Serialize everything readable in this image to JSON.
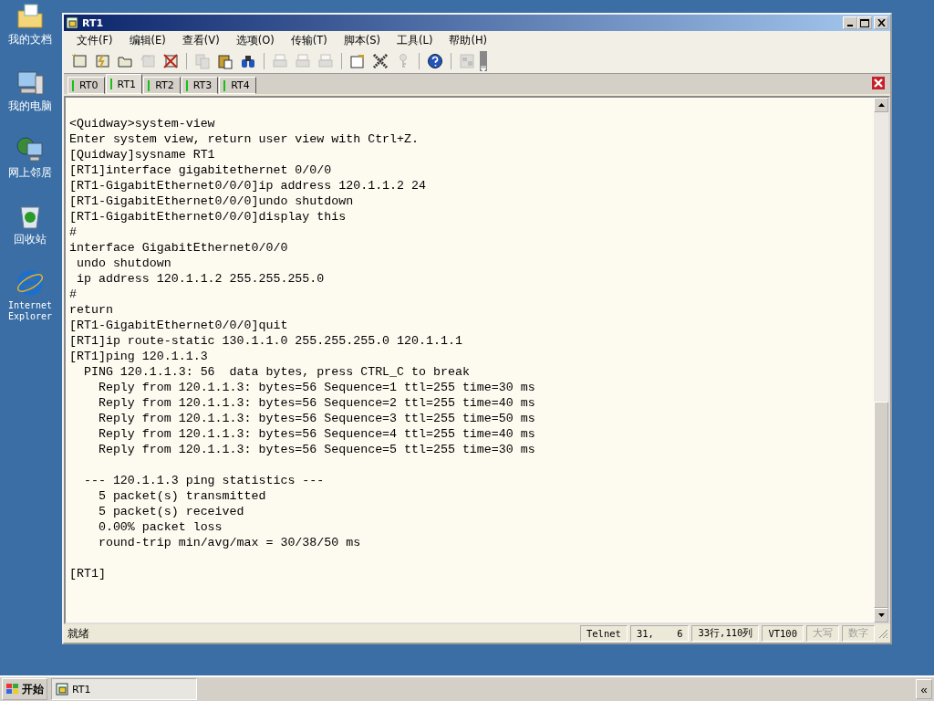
{
  "desktop_icons": [
    {
      "kind": "documents",
      "label": "我的文档"
    },
    {
      "kind": "computer",
      "label": "我的电脑"
    },
    {
      "kind": "network",
      "label": "网上邻居"
    },
    {
      "kind": "recycle",
      "label": "回收站"
    },
    {
      "kind": "browser",
      "label": "Internet Explorer"
    }
  ],
  "window": {
    "title": "RT1"
  },
  "menu": [
    "文件(F)",
    "编辑(E)",
    "查看(V)",
    "选项(O)",
    "传输(T)",
    "脚本(S)",
    "工具(L)",
    "帮助(H)"
  ],
  "toolbar": [
    {
      "kind": "connect",
      "disabled": false
    },
    {
      "kind": "quick-connect",
      "disabled": false
    },
    {
      "kind": "folder",
      "disabled": false
    },
    {
      "kind": "reconnect",
      "disabled": true
    },
    {
      "kind": "disconnect",
      "disabled": false
    },
    {
      "kind": "separator"
    },
    {
      "kind": "copy",
      "disabled": true
    },
    {
      "kind": "paste",
      "disabled": false
    },
    {
      "kind": "find",
      "disabled": false
    },
    {
      "kind": "separator"
    },
    {
      "kind": "print",
      "disabled": true
    },
    {
      "kind": "print-setup",
      "disabled": true
    },
    {
      "kind": "printer",
      "disabled": true
    },
    {
      "kind": "separator"
    },
    {
      "kind": "options",
      "disabled": false
    },
    {
      "kind": "tools",
      "disabled": false
    },
    {
      "kind": "key",
      "disabled": true
    },
    {
      "kind": "separator"
    },
    {
      "kind": "help",
      "disabled": false
    },
    {
      "kind": "separator"
    },
    {
      "kind": "window",
      "disabled": true
    }
  ],
  "tabs": [
    {
      "label": "RT0",
      "selected": false
    },
    {
      "label": "RT1",
      "selected": true
    },
    {
      "label": "RT2",
      "selected": false
    },
    {
      "label": "RT3",
      "selected": false
    },
    {
      "label": "RT4",
      "selected": false
    }
  ],
  "terminal": {
    "lines": [
      {
        "kind": "text",
        "text": "<Quidway>system-view"
      },
      {
        "kind": "text",
        "text": "Enter system view, return user view with Ctrl+Z."
      },
      {
        "kind": "text",
        "text": "[Quidway]sysname RT1"
      },
      {
        "kind": "text",
        "text": "[RT1]interface gigabitethernet 0/0/0"
      },
      {
        "kind": "text",
        "text": "[RT1-GigabitEthernet0/0/0]ip address 120.1.1.2 24"
      },
      {
        "kind": "text",
        "text": "[RT1-GigabitEthernet0/0/0]undo shutdown"
      },
      {
        "kind": "text",
        "text": "[RT1-GigabitEthernet0/0/0]display this"
      },
      {
        "kind": "text",
        "text": "#"
      },
      {
        "kind": "text",
        "text": "interface GigabitEthernet0/0/0"
      },
      {
        "kind": "text",
        "text": " undo shutdown"
      },
      {
        "kind": "text",
        "text": " ip address 120.1.1.2 255.255.255.0"
      },
      {
        "kind": "text",
        "text": "#"
      },
      {
        "kind": "text",
        "text": "return"
      },
      {
        "kind": "text",
        "text": "[RT1-GigabitEthernet0/0/0]quit"
      },
      {
        "kind": "text",
        "text": "[RT1]ip route-static 130.1.1.0 255.255.255.0 120.1.1.1"
      },
      {
        "kind": "text",
        "text": "[RT1]ping 120.1.1.3"
      },
      {
        "kind": "text",
        "text": "  PING 120.1.1.3: 56  data bytes, press CTRL_C to break"
      },
      {
        "kind": "text",
        "text": "    Reply from 120.1.1.3: bytes=56 Sequence=1 ttl=255 time=30 ms"
      },
      {
        "kind": "text",
        "text": "    Reply from 120.1.1.3: bytes=56 Sequence=2 ttl=255 time=40 ms"
      },
      {
        "kind": "text",
        "text": "    Reply from 120.1.1.3: bytes=56 Sequence=3 ttl=255 time=50 ms"
      },
      {
        "kind": "text",
        "text": "    Reply from 120.1.1.3: bytes=56 Sequence=4 ttl=255 time=40 ms"
      },
      {
        "kind": "text",
        "text": "    Reply from 120.1.1.3: bytes=56 Sequence=5 ttl=255 time=30 ms"
      },
      {
        "kind": "blank"
      },
      {
        "kind": "text",
        "text": "  --- 120.1.1.3 ping statistics ---"
      },
      {
        "kind": "text",
        "text": "    5 packet(s) transmitted"
      },
      {
        "kind": "text",
        "text": "    5 packet(s) received"
      },
      {
        "kind": "text",
        "text": "    0.00% packet loss"
      },
      {
        "kind": "text",
        "text": "    round-trip min/avg/max = 30/38/50 ms"
      },
      {
        "kind": "blank"
      },
      {
        "kind": "text",
        "text": "[RT1]"
      }
    ]
  },
  "status_bar": {
    "message": "就绪",
    "cells": [
      {
        "text": "Telnet",
        "disabled": false
      },
      {
        "text": "31,    6",
        "disabled": false
      },
      {
        "text": "33行,110列",
        "disabled": false
      },
      {
        "text": "VT100",
        "disabled": false
      },
      {
        "text": "大写",
        "disabled": true
      },
      {
        "text": "数字",
        "disabled": true
      }
    ]
  },
  "taskbar": {
    "start": "开始",
    "tasks": [
      {
        "label": "RT1",
        "selected": false
      }
    ],
    "tray_button": "«"
  }
}
